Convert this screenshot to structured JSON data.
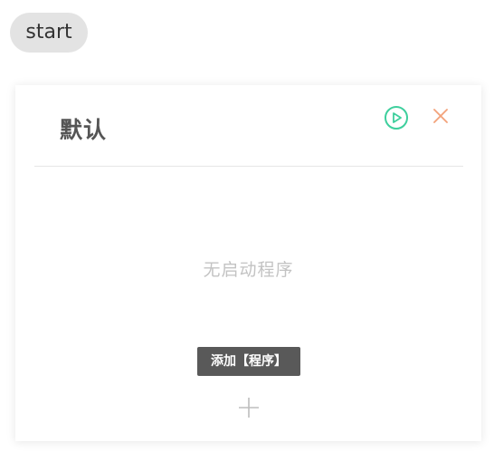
{
  "start_button": {
    "label": "start"
  },
  "card": {
    "title": "默认",
    "play_icon": "play-circle-icon",
    "close_icon": "close-icon",
    "empty_message": "无启动程序",
    "add_tooltip": "添加【程序】",
    "add_icon": "plus-icon"
  },
  "colors": {
    "play": "#3ecf9d",
    "close": "#f3a27a",
    "start_bg": "#e3e3e3",
    "tooltip_bg": "#595959",
    "empty_text": "#c3c3c3"
  }
}
